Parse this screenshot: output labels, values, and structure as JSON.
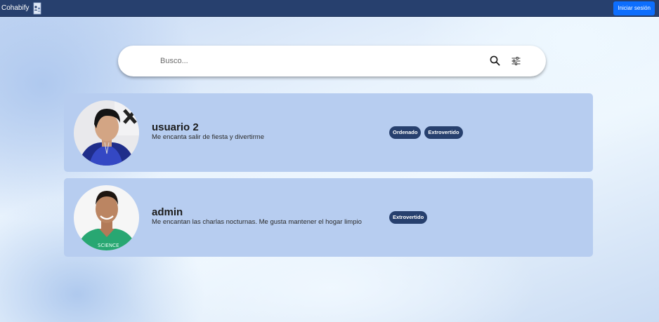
{
  "header": {
    "brand": "Cohabify",
    "login_label": "Iniciar sesión",
    "logo_icon": "house-people-icon"
  },
  "search": {
    "placeholder": "Busco...",
    "value": "",
    "search_icon": "search-icon",
    "filter_icon": "sliders-icon"
  },
  "results": [
    {
      "username": "usuario 2",
      "bio": "Me encanta salir de fiesta y divertirme",
      "tags": [
        "Ordenado",
        "Extrovertido"
      ]
    },
    {
      "username": "admin",
      "bio": "Me encantan las charlas nocturnas. Me gusta mantener el hogar limpio",
      "tags": [
        "Extrovertido"
      ]
    }
  ],
  "colors": {
    "navbar": "#27406e",
    "login_button": "#0d6efd",
    "card": "#b7cdf0",
    "tag": "#27406e"
  }
}
